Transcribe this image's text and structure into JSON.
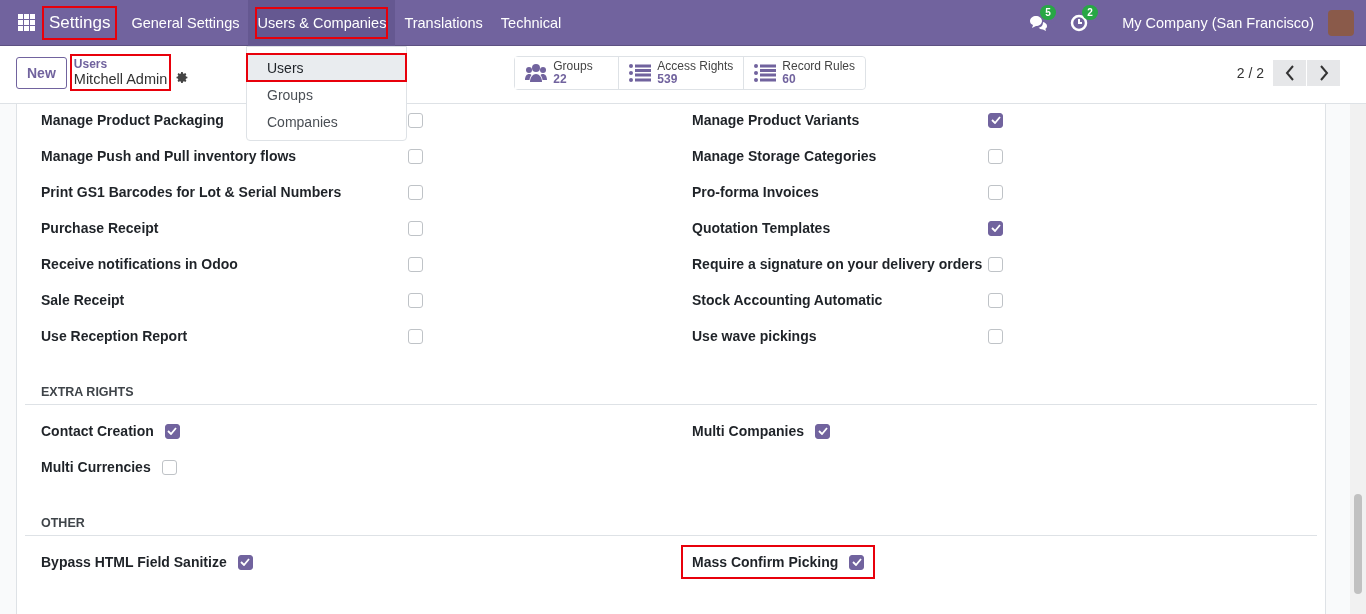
{
  "navbar": {
    "brand": {
      "label": "Settings",
      "highlighted": true
    },
    "menu": [
      {
        "label": "General Settings",
        "selected": false,
        "highlighted": false
      },
      {
        "label": "Users & Companies",
        "selected": true,
        "highlighted": true
      },
      {
        "label": "Translations",
        "selected": false,
        "highlighted": false
      },
      {
        "label": "Technical",
        "selected": false,
        "highlighted": false
      }
    ],
    "messages_badge": "5",
    "activities_badge": "2",
    "company": "My Company (San Francisco)"
  },
  "dropdown": {
    "items": [
      {
        "label": "Users",
        "selected": true,
        "highlighted": true
      },
      {
        "label": "Groups",
        "selected": false,
        "highlighted": false
      },
      {
        "label": "Companies",
        "selected": false,
        "highlighted": false
      }
    ]
  },
  "control_panel": {
    "new_button": "New",
    "breadcrumb": {
      "parent": "Users",
      "current": "Mitchell Admin",
      "highlighted": true
    },
    "stat_buttons": [
      {
        "kind": "users",
        "label": "Groups",
        "value": "22"
      },
      {
        "kind": "list",
        "label": "Access Rights",
        "value": "539"
      },
      {
        "kind": "list",
        "label": "Record Rules",
        "value": "60"
      }
    ],
    "pager": "2 / 2"
  },
  "sections": [
    {
      "kind": "aligned",
      "items": [
        {
          "label": "Manage Product Packaging",
          "checked": false,
          "highlighted": false
        },
        {
          "label": "Manage Product Variants",
          "checked": true,
          "highlighted": false
        },
        {
          "label": "Manage Push and Pull inventory flows",
          "checked": false,
          "highlighted": false
        },
        {
          "label": "Manage Storage Categories",
          "checked": false,
          "highlighted": false
        },
        {
          "label": "Print GS1 Barcodes for Lot & Serial Numbers",
          "checked": false,
          "highlighted": false
        },
        {
          "label": "Pro-forma Invoices",
          "checked": false,
          "highlighted": false
        },
        {
          "label": "Purchase Receipt",
          "checked": false,
          "highlighted": false
        },
        {
          "label": "Quotation Templates",
          "checked": true,
          "highlighted": false
        },
        {
          "label": "Receive notifications in Odoo",
          "checked": false,
          "highlighted": false
        },
        {
          "label": "Require a signature on your delivery orders",
          "checked": false,
          "highlighted": false
        },
        {
          "label": "Sale Receipt",
          "checked": false,
          "highlighted": false
        },
        {
          "label": "Stock Accounting Automatic",
          "checked": false,
          "highlighted": false
        },
        {
          "label": "Use Reception Report",
          "checked": false,
          "highlighted": false
        },
        {
          "label": "Use wave pickings",
          "checked": false,
          "highlighted": false
        }
      ]
    },
    {
      "title": "EXTRA RIGHTS",
      "kind": "inline",
      "items": [
        {
          "label": "Contact Creation",
          "checked": true,
          "highlighted": false
        },
        {
          "label": "Multi Companies",
          "checked": true,
          "highlighted": false
        },
        {
          "label": "Multi Currencies",
          "checked": false,
          "highlighted": false
        }
      ]
    },
    {
      "title": "OTHER",
      "kind": "inline",
      "items": [
        {
          "label": "Bypass HTML Field Sanitize",
          "checked": true,
          "highlighted": false
        },
        {
          "label": "Mass Confirm Picking",
          "checked": true,
          "highlighted": true
        }
      ]
    }
  ]
}
